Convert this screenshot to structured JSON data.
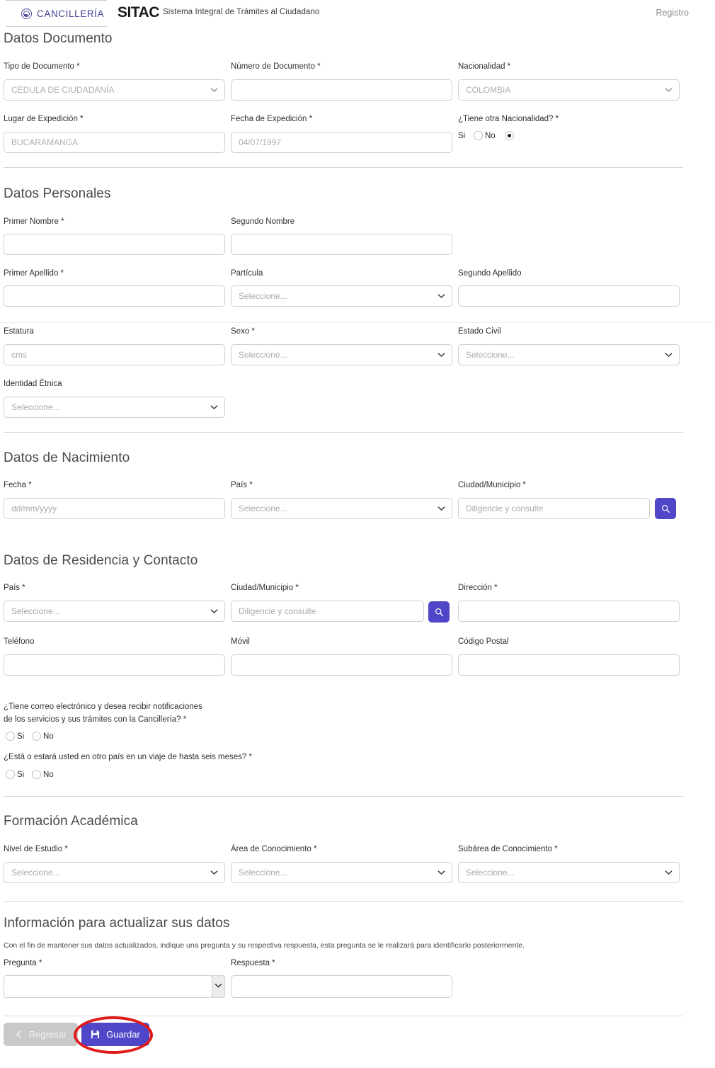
{
  "header": {
    "logo_text": "CANCILLERÍA",
    "logo_icon": "colombia-emblem-icon",
    "brand": "SITAC",
    "brand_subtitle": "Sistema Integral de Trámites al Ciudadano",
    "registro_link": "Registro"
  },
  "colors": {
    "accent": "#5046c8",
    "logo": "#3f3f93",
    "annotation": "#e01b1b",
    "border": "#cfcfcf",
    "placeholder": "#a9a9a9"
  },
  "sections": {
    "documento": {
      "title": "Datos Documento",
      "tipo_label": "Tipo de Documento *",
      "tipo_value": "CÉDULA DE CIUDADANÍA",
      "numero_label": "Número de Documento *",
      "numero_value": "",
      "nacionalidad_label": "Nacionalidad *",
      "nacionalidad_value": "COLOMBIA",
      "lugar_label": "Lugar de Expedición *",
      "lugar_value": "BUCARAMANGA",
      "fecha_label": "Fecha de Expedición *",
      "fecha_value": "04/07/1997",
      "otra_nac_label": "¿Tiene otra Nacionalidad? *",
      "otra_nac_si": "Si",
      "otra_nac_no": "No",
      "otra_nac_selected": "No"
    },
    "personales": {
      "title": "Datos Personales",
      "primer_nombre_label": "Primer Nombre *",
      "primer_nombre_value": "",
      "segundo_nombre_label": "Segundo Nombre",
      "segundo_nombre_value": "",
      "primer_apellido_label": "Primer Apellido *",
      "primer_apellido_value": "",
      "particula_label": "Partícula",
      "particula_value": "Seleccione...",
      "segundo_apellido_label": "Segundo Apellido",
      "segundo_apellido_value": "",
      "estatura_label": "Estatura",
      "estatura_placeholder": "cms",
      "sexo_label": "Sexo *",
      "sexo_value": "Seleccione...",
      "estado_civil_label": "Estado Civil",
      "estado_civil_value": "Seleccione...",
      "identidad_label": "Identidad Étnica",
      "identidad_value": "Seleccione..."
    },
    "nacimiento": {
      "title": "Datos de Nacimiento",
      "fecha_label": "Fecha *",
      "fecha_placeholder": "dd/mm/yyyy",
      "pais_label": "País *",
      "pais_value": "Seleccione...",
      "ciudad_label": "Ciudad/Municipio *",
      "ciudad_placeholder": "Diligencie y consulte",
      "search_icon": "search-icon"
    },
    "residencia": {
      "title": "Datos de Residencia y Contacto",
      "pais_label": "País *",
      "pais_value": "Seleccione...",
      "ciudad_label": "Ciudad/Municipio *",
      "ciudad_placeholder": "Diligencie y consulte",
      "direccion_label": "Dirección *",
      "direccion_value": "",
      "telefono_label": "Teléfono",
      "telefono_value": "",
      "movil_label": "Móvil",
      "movil_value": "",
      "codigo_postal_label": "Código Postal",
      "codigo_postal_value": "",
      "q_correo_line1": "¿Tiene correo electrónico y desea recibir notificaciones",
      "q_correo_line2": "de los servicios y sus trámites con la Cancillería? *",
      "q_correo_si": "Si",
      "q_correo_no": "No",
      "q_viaje": "¿Está o estará usted en otro país en un viaje de hasta seis meses? *",
      "q_viaje_si": "Si",
      "q_viaje_no": "No"
    },
    "academica": {
      "title": "Formación Académica",
      "nivel_label": "Nivel de Estudio *",
      "nivel_value": "Seleccione...",
      "area_label": "Área de Conocimiento *",
      "area_value": "Seleccione...",
      "subarea_label": "Subárea de Conocimiento *",
      "subarea_value": "Seleccione..."
    },
    "actualizar": {
      "title": "Información para actualizar sus datos",
      "helper": "Con el fin de mantener sus datos actualizados, indique una pregunta y su respectiva respuesta, esta pregunta se le realizará para identificarlo posteriormente.",
      "pregunta_label": "Pregunta *",
      "pregunta_value": "",
      "respuesta_label": "Respuesta *",
      "respuesta_value": ""
    }
  },
  "footer": {
    "back_label": "Regresar",
    "back_icon": "chevron-left-icon",
    "save_label": "Guardar",
    "save_icon": "floppy-disk-icon"
  }
}
